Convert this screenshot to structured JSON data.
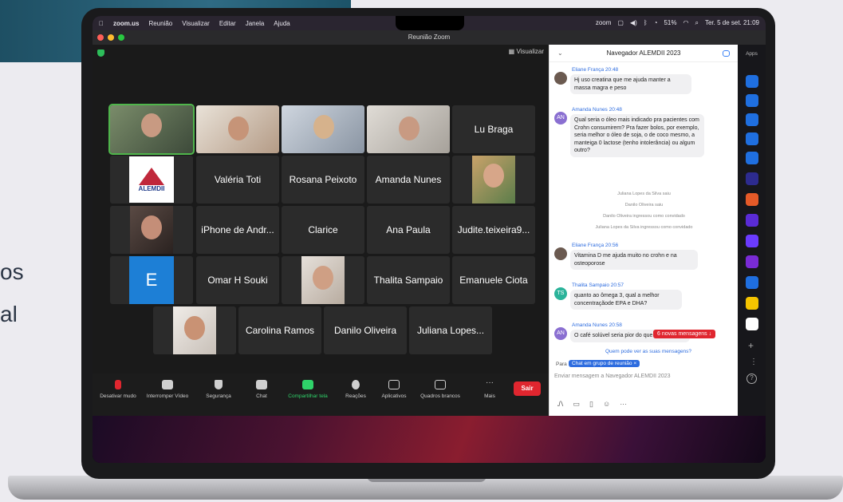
{
  "background": {
    "side_text_lines": [
      "os",
      "al"
    ]
  },
  "menubar": {
    "items": [
      "zoom.us",
      "Reunião",
      "Visualizar",
      "Editar",
      "Janela",
      "Ajuda"
    ],
    "zoom_label": "zoom",
    "battery": "51%",
    "datetime": "Ter. 5 de set. 21:09"
  },
  "window": {
    "title": "Reunião Zoom",
    "view_button": "Visualizar"
  },
  "tiles": [
    {
      "name": "",
      "type": "video"
    },
    {
      "name": "",
      "type": "video"
    },
    {
      "name": "",
      "type": "video"
    },
    {
      "name": "",
      "type": "video"
    },
    {
      "name": "Lu Braga",
      "type": "name"
    },
    {
      "name": "",
      "type": "logo",
      "logo_text": "ALEMDII"
    },
    {
      "name": "Valéria Toti",
      "type": "name"
    },
    {
      "name": "Rosana Peixoto",
      "type": "name"
    },
    {
      "name": "Amanda Nunes",
      "type": "name"
    },
    {
      "name": "",
      "type": "photo"
    },
    {
      "name": "",
      "type": "photo"
    },
    {
      "name": "iPhone de Andr...",
      "type": "name"
    },
    {
      "name": "Clarice",
      "type": "name"
    },
    {
      "name": "Ana Paula",
      "type": "name"
    },
    {
      "name": "Judite.teixeira9...",
      "type": "name"
    },
    {
      "name": "E",
      "type": "letter"
    },
    {
      "name": "Omar H Souki",
      "type": "name"
    },
    {
      "name": "",
      "type": "photo"
    },
    {
      "name": "Thalita Sampaio",
      "type": "name"
    },
    {
      "name": "Emanuele Ciota",
      "type": "name"
    },
    {
      "name": "",
      "type": "photo"
    },
    {
      "name": "Carolina Ramos",
      "type": "name"
    },
    {
      "name": "Danilo Oliveira",
      "type": "name"
    },
    {
      "name": "Juliana Lopes...",
      "type": "name"
    }
  ],
  "toolbar": {
    "mute": "Desativar mudo",
    "video": "Interromper Vídeo",
    "security": "Segurança",
    "chat": "Chat",
    "share": "Compartilhar tela",
    "reactions": "Reações",
    "apps": "Aplicativos",
    "whiteboards": "Quadros brancos",
    "more": "Mais",
    "leave": "Sair"
  },
  "chat": {
    "title": "Navegador ALEMDII 2023",
    "messages": [
      {
        "sender": "Eliane França  20:48",
        "initials": "",
        "text": "Hj uso creatina  que me ajuda manter a massa magra e peso"
      },
      {
        "sender": "Amanda Nunes  20:48",
        "initials": "AN",
        "text": "Qual seria o óleo mais indicado pra pacientes com Crohn consumirem? Pra fazer bolos, por exemplo, seria melhor o óleo de soja, o de coco mesmo, a manteiga 0 lactose (tenho intolerância) ou algum outro?"
      },
      {
        "sender": "Eliane França  20:56",
        "initials": "",
        "text": "Vitamina D me ajuda muito no crohn e na osteoporose"
      },
      {
        "sender": "Thalita Sampaio  20:57",
        "initials": "TS",
        "text": "quanto ao ômega 3, qual a melhor concentraçãode EPA e DHA?"
      },
      {
        "sender": "Amanda Nunes  20:58",
        "initials": "AN",
        "text": "O café solúvel seria pior do que o em pó..."
      }
    ],
    "system": [
      "Juliana Lopes da Silva saiu",
      "Danilo Oliveira saiu",
      "Danilo Oliveira ingressou como convidado",
      "Juliana Lopes da Silva ingressou como convidado"
    ],
    "new_messages": "6 novas mensagens ↓",
    "who_can_see": "Quem pode ver as suas mensagens?",
    "to_label": "Para",
    "to_chip": "Chat em grupo de reunião ×",
    "input_placeholder": "Enviar mensagem a Navegador ALEMDII 2023"
  },
  "apps_bar": {
    "label": "Apps",
    "icons": [
      "#1f6fe0",
      "#1f6fe0",
      "#1f6fe0",
      "#1f6fe0",
      "#1f6fe0",
      "#2d2b8f",
      "#e55a28",
      "#5a2bd6",
      "#6b3bff",
      "#7a2bd6",
      "#1f6fe0",
      "#f5c400",
      "#ffffff"
    ]
  },
  "colors": {
    "accent_green": "#2fd36a",
    "leave_red": "#e0262f",
    "chat_blue": "#2d6cdf"
  }
}
